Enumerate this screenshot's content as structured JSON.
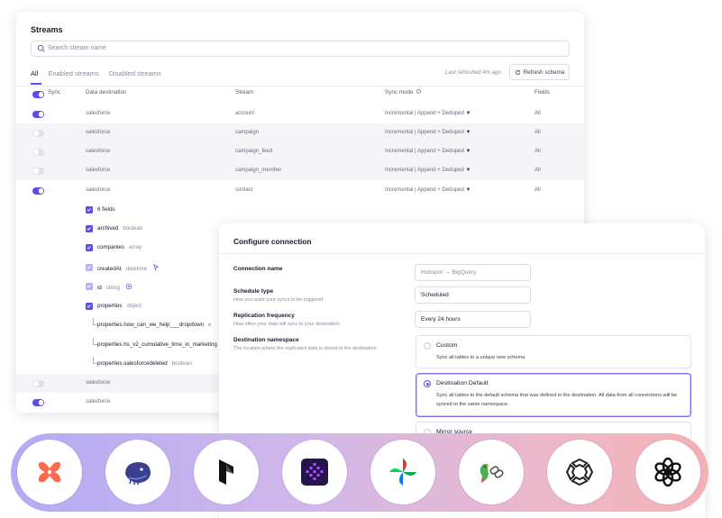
{
  "streams": {
    "title": "Streams",
    "search_placeholder": "Search stream name",
    "tabs": [
      "All",
      "Enabled streams",
      "Disabled streams"
    ],
    "last_refreshed": "Last refreshed 4m ago",
    "refresh_button": "Refresh schema",
    "headers": {
      "sync": "Sync",
      "destination": "Data destination",
      "stream": "Stream",
      "sync_mode": "Sync mode",
      "fields": "Fields"
    },
    "rows": [
      {
        "enabled": true,
        "destination": "salesforce",
        "stream": "account",
        "sync_mode": "Incremental | Append + Deduped",
        "fields": "All"
      },
      {
        "enabled": false,
        "destination": "salesforce",
        "stream": "campaign",
        "sync_mode": "Incremental | Append + Deduped",
        "fields": "All"
      },
      {
        "enabled": false,
        "destination": "salesforce",
        "stream": "campaign_feed",
        "sync_mode": "Incremental | Append + Deduped",
        "fields": "All"
      },
      {
        "enabled": false,
        "destination": "salesforce",
        "stream": "campaign_member",
        "sync_mode": "Incremental | Append + Deduped",
        "fields": "All"
      },
      {
        "enabled": true,
        "destination": "salesforce",
        "stream": "contact",
        "sync_mode": "Incremental | Append + Deduped",
        "fields": "All"
      }
    ],
    "field_count": "6 fields",
    "fields": [
      {
        "name": "archived",
        "type": "boolean"
      },
      {
        "name": "companies",
        "type": "array"
      },
      {
        "name": "createdAt",
        "type": "datetime"
      },
      {
        "name": "id",
        "type": "string"
      },
      {
        "name": "properties",
        "type": "object"
      }
    ],
    "subfields": [
      {
        "name": "properties.how_can_we_help___dropdown",
        "type": "e"
      },
      {
        "name": "properties.hs_v2_cumulative_time_in_marketing",
        "type": ""
      },
      {
        "name": "properties.salesforcedeleted",
        "type": "boolean"
      }
    ],
    "bottom_rows": [
      {
        "enabled": false,
        "destination": "salesforce"
      },
      {
        "enabled": true,
        "destination": "salesforce"
      }
    ]
  },
  "config": {
    "title": "Configure connection",
    "connection_name": {
      "label": "Connection name",
      "placeholder": "Hubspot → BigQuery"
    },
    "schedule_type": {
      "label": "Schedule type",
      "sub": "How you want your syncs to be triggered",
      "value": "Scheduled"
    },
    "replication_frequency": {
      "label": "Replication frequency",
      "sub": "How often your data will sync to your destination",
      "value": "Every 24 hours"
    },
    "destination_namespace": {
      "label": "Destination namespace",
      "sub": "The location where the replicated data is stored in the destination"
    },
    "options": [
      {
        "title": "Custom",
        "desc": "Sync all tables to a unique new schema",
        "selected": false
      },
      {
        "title": "Destination Default",
        "desc": "Sync all tables to the default schema that was defined in the destination. All data from all connections will be synced to the same namespace.",
        "selected": true
      },
      {
        "title": "Mirror source",
        "desc": "",
        "selected": false
      }
    ]
  },
  "logos": [
    "dbt-icon",
    "mage-whale-icon",
    "prefect-icon",
    "kestra-icon",
    "airflow-pinwheel-icon",
    "langchain-parrot-icon",
    "dagster-icon",
    "openai-icon"
  ]
}
